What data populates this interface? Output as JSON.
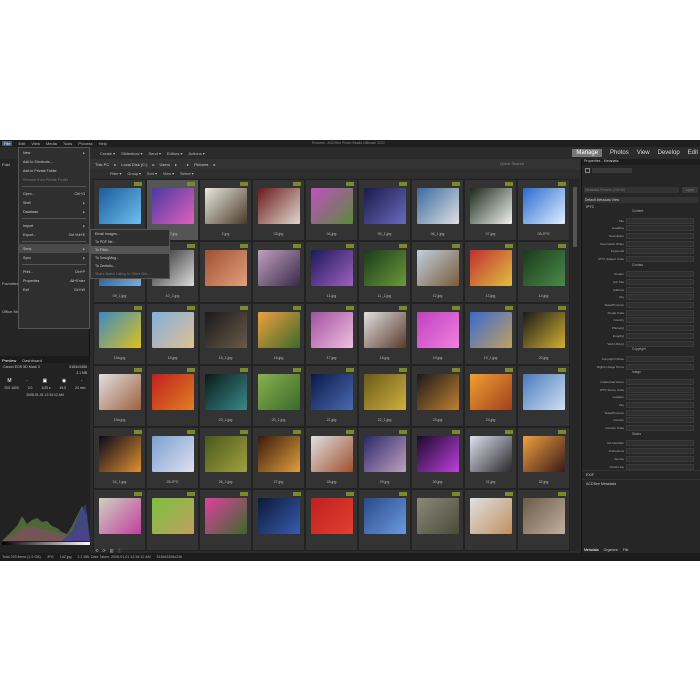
{
  "app": {
    "title": "Pictures - ACDSee Photo Studio Ultimate 2022"
  },
  "menubar": [
    "File",
    "Edit",
    "View",
    "Media",
    "Tools",
    "Process",
    "Help"
  ],
  "modes": [
    "Manage",
    "Photos",
    "View",
    "Develop",
    "Edit"
  ],
  "toolbar": [
    "Create ▾",
    "Slideshow ▾",
    "Send ▾",
    "Editors ▾",
    "Actions ▾"
  ],
  "file_menu": [
    {
      "label": "New",
      "key": "▸"
    },
    {
      "label": "Add to Shortcuts...",
      "key": ""
    },
    {
      "label": "Add to Private Folder",
      "key": ""
    },
    {
      "label": "Remove from Private Folder",
      "key": "",
      "disabled": true
    },
    {
      "sep": true
    },
    {
      "label": "Open...",
      "key": "Ctrl+O"
    },
    {
      "label": "Shell",
      "key": "▸"
    },
    {
      "label": "Database",
      "key": "▸"
    },
    {
      "sep": true
    },
    {
      "label": "Import",
      "key": "▸"
    },
    {
      "label": "Export...",
      "key": "Ctrl+Alt+E"
    },
    {
      "sep": true
    },
    {
      "label": "Send",
      "key": "▸",
      "hl": true
    },
    {
      "label": "Sync",
      "key": "▸"
    },
    {
      "sep": true
    },
    {
      "label": "Print...",
      "key": "Ctrl+P"
    },
    {
      "label": "Properties",
      "key": "Alt+Enter"
    },
    {
      "label": "Exit",
      "key": "Ctrl+W"
    }
  ],
  "send_menu": [
    {
      "label": "Email Images..."
    },
    {
      "label": "To PDF file..."
    },
    {
      "label": "To Flickr...",
      "hl": true
    },
    {
      "label": "To SmugMug..."
    },
    {
      "label": "To Zenfolio..."
    },
    {
      "label": "Share Batch Listing to Other Site...",
      "disabled": true
    }
  ],
  "folders": {
    "label": "Fold",
    "items": [
      "Favorites",
      "",
      "Office Media"
    ]
  },
  "breadcrumb": [
    "This PC",
    "Local Disk (C:)",
    "Users",
    "",
    "Pictures"
  ],
  "quick_search": "Quick Search",
  "filters": [
    "Filter ▾",
    "Group ▾",
    "Sort ▾",
    "View ▾",
    "Select ▾"
  ],
  "preview": {
    "tabs": [
      "Preview",
      "Dashboard"
    ],
    "camera": "Canon EOS 5D Mark II",
    "res": "5184x3456",
    "size": "3.1 MB",
    "mode": "M",
    "iso": "ISO 1600",
    "ev": "0.0",
    "shutter": "1/25 s",
    "aperture": "f/4.0",
    "focal": "24 mm",
    "date": "2008-01-01 12:34:12 AM"
  },
  "thumbs": [
    {
      "n": "01.jpg",
      "c": [
        "#1a5a9a",
        "#6fc0f0"
      ]
    },
    {
      "n": "02.jpg",
      "c": [
        "#4a3aa0",
        "#e060c0"
      ],
      "sel": true
    },
    {
      "n": "2.jpg",
      "c": [
        "#e8e8e0",
        "#4a3a2a"
      ]
    },
    {
      "n": "03.jpg",
      "c": [
        "#6a1a1a",
        "#e0d8d0"
      ]
    },
    {
      "n": "04.jpg",
      "c": [
        "#c050c0",
        "#5a8a3a"
      ]
    },
    {
      "n": "05_1.jpg",
      "c": [
        "#1a1a4a",
        "#6a6ac0"
      ]
    },
    {
      "n": "06_1.jpg",
      "c": [
        "#3a6aa0",
        "#e0e0e0"
      ]
    },
    {
      "n": "07.jpg",
      "c": [
        "#1a2a1a",
        "#f0f0f0"
      ]
    },
    {
      "n": "08.JPG",
      "c": [
        "#2a6ad0",
        "#e0f0ff"
      ]
    },
    {
      "n": "09_1.jpg",
      "c": [
        "#0a3a6a",
        "#7ab0e0"
      ]
    },
    {
      "n": "10_2.jpg",
      "c": [
        "#222",
        "#ddd"
      ]
    },
    {
      "n": "",
      "c": [
        "#a05030",
        "#e0a080"
      ]
    },
    {
      "n": "",
      "c": [
        "#c0a0c0",
        "#3a2a4a"
      ]
    },
    {
      "n": "11.jpg",
      "c": [
        "#1a1a5a",
        "#a060c0"
      ]
    },
    {
      "n": "11_1.jpg",
      "c": [
        "#1a3a1a",
        "#6a9a3a"
      ]
    },
    {
      "n": "12.jpg",
      "c": [
        "#c0d0e0",
        "#7a5a3a"
      ]
    },
    {
      "n": "13.jpg",
      "c": [
        "#c03030",
        "#e0c040"
      ]
    },
    {
      "n": "14.jpg",
      "c": [
        "#1a3a1a",
        "#4a8a4a"
      ]
    },
    {
      "n": "15a.jpg",
      "c": [
        "#3a8ac0",
        "#e0c020"
      ]
    },
    {
      "n": "15.jpg",
      "c": [
        "#80b0e0",
        "#e0c090"
      ]
    },
    {
      "n": "15_1.jpg",
      "c": [
        "#1a1a1a",
        "#6a5a4a"
      ]
    },
    {
      "n": "16.jpg",
      "c": [
        "#f0a040",
        "#3a6a2a"
      ]
    },
    {
      "n": "17.jpg",
      "c": [
        "#a050a0",
        "#f0c0e0"
      ]
    },
    {
      "n": "18.jpg",
      "c": [
        "#e0e0e0",
        "#5a3a2a"
      ]
    },
    {
      "n": "19.jpg",
      "c": [
        "#c040c0",
        "#f080e0"
      ]
    },
    {
      "n": "19_1.jpg",
      "c": [
        "#3a6ad0",
        "#c0a060"
      ]
    },
    {
      "n": "20.jpg",
      "c": [
        "#1a1a1a",
        "#d0b030"
      ]
    },
    {
      "n": "19a.jpg",
      "c": [
        "#e0e0e0",
        "#a06040"
      ]
    },
    {
      "n": "",
      "c": [
        "#c02020",
        "#e08020"
      ]
    },
    {
      "n": "20_1.jpg",
      "c": [
        "#0a1a1a",
        "#3a8a8a"
      ]
    },
    {
      "n": "20_1.jpg",
      "c": [
        "#8ab050",
        "#3a6a2a"
      ]
    },
    {
      "n": "21.jpg",
      "c": [
        "#0a1a4a",
        "#4a6ab0"
      ]
    },
    {
      "n": "22_1.jpg",
      "c": [
        "#6a5a1a",
        "#d0b040"
      ]
    },
    {
      "n": "23.jpg",
      "c": [
        "#1a1a1a",
        "#c08030"
      ]
    },
    {
      "n": "24.jpg",
      "c": [
        "#f0a030",
        "#a04020"
      ]
    },
    {
      "n": "",
      "c": [
        "#4a7ac0",
        "#d0e0f0"
      ]
    },
    {
      "n": "24_1.jpg",
      "c": [
        "#0a0a1a",
        "#e09030"
      ]
    },
    {
      "n": "25.JPG",
      "c": [
        "#7aa0d0",
        "#e0e0f0"
      ]
    },
    {
      "n": "26_1.jpg",
      "c": [
        "#4a5a1a",
        "#a0a040"
      ]
    },
    {
      "n": "27.jpg",
      "c": [
        "#3a1a0a",
        "#e0a040"
      ]
    },
    {
      "n": "28.jpg",
      "c": [
        "#e0e0e0",
        "#a05030"
      ]
    },
    {
      "n": "29.jpg",
      "c": [
        "#2a2a6a",
        "#c0a0c0"
      ]
    },
    {
      "n": "30.jpg",
      "c": [
        "#1a0a2a",
        "#c040e0"
      ]
    },
    {
      "n": "31.jpg",
      "c": [
        "#e0e0f0",
        "#2a2a2a"
      ]
    },
    {
      "n": "32.jpg",
      "c": [
        "#f0a040",
        "#3a1a1a"
      ]
    },
    {
      "n": "",
      "c": [
        "#d0d0c0",
        "#c040a0"
      ]
    },
    {
      "n": "",
      "c": [
        "#7ac040",
        "#c0a060"
      ]
    },
    {
      "n": "",
      "c": [
        "#e040a0",
        "#3a6a2a"
      ]
    },
    {
      "n": "",
      "c": [
        "#0a1a3a",
        "#3a5ab0"
      ]
    },
    {
      "n": "",
      "c": [
        "#c02020",
        "#e04030"
      ]
    },
    {
      "n": "",
      "c": [
        "#2a4a8a",
        "#6a9ae0"
      ]
    },
    {
      "n": "",
      "c": [
        "#8a8a7a",
        "#4a4a3a"
      ]
    },
    {
      "n": "",
      "c": [
        "#e0e0e0",
        "#c09060"
      ]
    },
    {
      "n": "",
      "c": [
        "#6a5a4a",
        "#c0b0a0"
      ]
    }
  ],
  "properties": {
    "title": "Properties - Metadata",
    "preset": "Metadata Presets (Ctrl+M)",
    "apply": "Apply",
    "view": "Default Metadata View",
    "iptc": "IPTC",
    "fields": [
      {
        "sec": "Content"
      },
      {
        "l": "Title"
      },
      {
        "l": "Headline"
      },
      {
        "l": "Description"
      },
      {
        "l": "Description Writer"
      },
      {
        "l": "Keywords"
      },
      {
        "l": "IPTC Subject Code"
      },
      {
        "sec": "Contact"
      },
      {
        "l": "Creator"
      },
      {
        "l": "Job Title"
      },
      {
        "l": "Address"
      },
      {
        "l": "City"
      },
      {
        "l": "State/Province"
      },
      {
        "l": "Postal Code"
      },
      {
        "l": "Country"
      },
      {
        "l": "Phone(s)"
      },
      {
        "l": "Email(s)"
      },
      {
        "l": "Web URL(s)"
      },
      {
        "sec": "Copyright"
      },
      {
        "l": "Copyright Notice"
      },
      {
        "l": "Rights Usage Terms"
      },
      {
        "sec": "Image"
      },
      {
        "l": "Intellectual Genre"
      },
      {
        "l": "IPTC Scene Code"
      },
      {
        "l": "Location"
      },
      {
        "l": "City"
      },
      {
        "l": "State/Province"
      },
      {
        "l": "Country"
      },
      {
        "l": "Country Code"
      },
      {
        "sec": "Status"
      },
      {
        "l": "Job Identifier"
      },
      {
        "l": "Instructions"
      },
      {
        "l": "Source"
      },
      {
        "l": "Credit Line"
      }
    ],
    "exif": "EXIF",
    "acd": "ACDSee Metadata",
    "tabs": [
      "Metadata",
      "Organize",
      "File"
    ]
  },
  "status": [
    "Total 293 items (1.9 GB)",
    "JPG",
    "1d2.jpg",
    "2.1 MB, Date Taken: 2008-01-01 12:34:12 AM",
    "5184x3456x24b"
  ]
}
